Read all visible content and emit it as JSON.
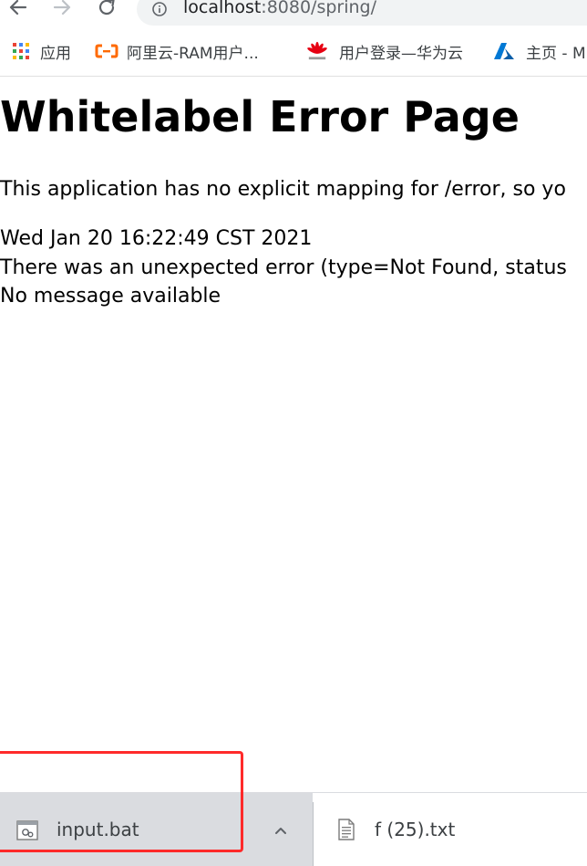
{
  "browser": {
    "address_bar": {
      "host": "localhost",
      "path": ":8080/spring/"
    },
    "bookmarks": [
      {
        "label": "应用",
        "icon": "apps-grid-icon"
      },
      {
        "label": "阿里云-RAM用户...",
        "icon": "aliyun-icon"
      },
      {
        "label": "用户登录—华为云",
        "icon": "huawei-icon"
      },
      {
        "label": "主页 - M",
        "icon": "azure-icon"
      }
    ]
  },
  "page": {
    "title": "Whitelabel Error Page",
    "lines": [
      "This application has no explicit mapping for /error, so yo",
      "Wed Jan 20 16:22:49 CST 2021",
      "There was an unexpected error (type=Not Found, status",
      "No message available"
    ]
  },
  "downloads": [
    {
      "name": "input.bat",
      "icon": "bat-file-icon"
    },
    {
      "name": "f (25).txt",
      "icon": "text-file-icon"
    }
  ],
  "colors": {
    "highlight": "#ff2a2a",
    "aliyun": "#ff6a00",
    "huawei": "#e60012",
    "azure": "#0078d4"
  }
}
